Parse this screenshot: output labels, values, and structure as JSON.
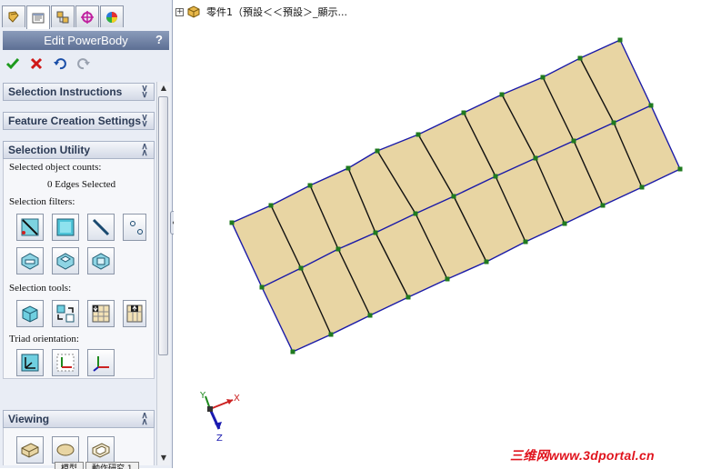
{
  "colors": {
    "panel_bg": "#e9edf5",
    "header_bg": "#6f80a3",
    "face_fill": "#e8d5a3",
    "edge_blue": "#1a1aa8",
    "vertex_green": "#1f7a1f",
    "axis_x": "#cc2222",
    "axis_y": "#1f8a1f",
    "axis_z": "#1a1ab0",
    "watermark": "#e0141e"
  },
  "tabs": [
    {
      "icon": "feature-manager-icon"
    },
    {
      "icon": "property-manager-icon"
    },
    {
      "icon": "configuration-manager-icon"
    },
    {
      "icon": "dimxpert-icon"
    },
    {
      "icon": "display-manager-icon"
    }
  ],
  "panel": {
    "title": "Edit PowerBody",
    "help": "?",
    "actions": [
      "ok-check-icon",
      "cancel-x-icon",
      "undo-icon",
      "redo-icon"
    ]
  },
  "groups": {
    "selection_instructions": {
      "title": "Selection Instructions",
      "state": "collapsed"
    },
    "feature_creation": {
      "title": "Feature Creation Settings",
      "state": "collapsed"
    },
    "selection_utility": {
      "title": "Selection Utility",
      "state": "expanded",
      "counts_label": "Selected object counts:",
      "counts_value": "0 Edges Selected",
      "filters_label": "Selection filters:",
      "filters_row1": [
        "edge-filter-icon",
        "face-filter-icon",
        "line-filter-icon",
        "vertex-filter-icon"
      ],
      "filters_row2": [
        "body-filter-1-icon",
        "body-filter-2-icon",
        "body-filter-3-icon"
      ],
      "tools_label": "Selection tools:",
      "tools": [
        "select-body-icon",
        "swap-select-icon",
        "select-down-icon",
        "select-up-icon"
      ],
      "triad_label": "Triad orientation:",
      "triad": [
        "triad-view-icon",
        "triad-local-icon",
        "triad-global-icon"
      ]
    },
    "viewing": {
      "title": "Viewing",
      "state": "expanded",
      "tools": [
        "box-view-icon",
        "ellipse-view-icon",
        "transparent-view-icon"
      ]
    }
  },
  "bottom_tabs": [
    "模型",
    "動作研究 1"
  ],
  "viewport": {
    "tree_expander": "+",
    "tree_label": "零件1（預設＜＜預設＞_顯示...",
    "axis_labels": {
      "x": "X",
      "y": "Y",
      "z": "Z"
    }
  },
  "watermark": "三维网www.3dportal.cn"
}
